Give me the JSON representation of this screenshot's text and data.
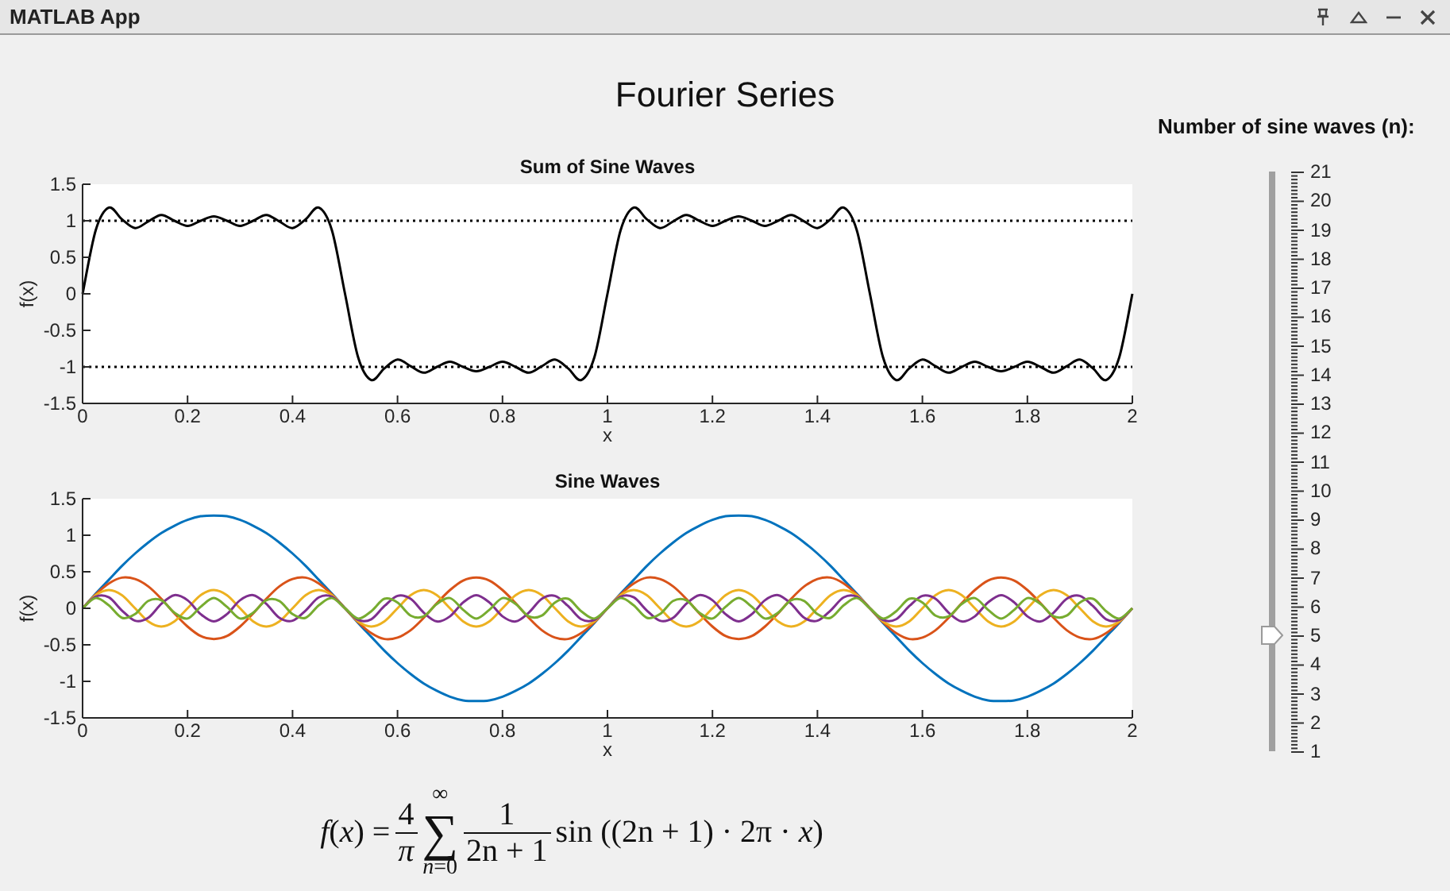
{
  "window": {
    "title": "MATLAB App"
  },
  "heading": "Fourier Series",
  "charts": [
    {
      "chart_data": {
        "type": "line",
        "title": "Sum of Sine Waves",
        "xlabel": "x",
        "ylabel": "f(x)",
        "xlim": [
          0,
          2
        ],
        "ylim": [
          -1.5,
          1.5
        ],
        "xticks": [
          {
            "value": 0,
            "label": "0"
          },
          {
            "value": 0.2,
            "label": "0.2"
          },
          {
            "value": 0.4,
            "label": "0.4"
          },
          {
            "value": 0.6,
            "label": "0.6"
          },
          {
            "value": 0.8,
            "label": "0.8"
          },
          {
            "value": 1,
            "label": "1"
          },
          {
            "value": 1.2,
            "label": "1.2"
          },
          {
            "value": 1.4,
            "label": "1.4"
          },
          {
            "value": 1.6,
            "label": "1.6"
          },
          {
            "value": 1.8,
            "label": "1.8"
          },
          {
            "value": 2,
            "label": "2"
          }
        ],
        "yticks": [
          {
            "value": -1.5,
            "label": "-1.5"
          },
          {
            "value": -1,
            "label": "-1"
          },
          {
            "value": -0.5,
            "label": "-0.5"
          },
          {
            "value": 0,
            "label": "0"
          },
          {
            "value": 0.5,
            "label": "0.5"
          },
          {
            "value": 1,
            "label": "1"
          },
          {
            "value": 1.5,
            "label": "1.5"
          }
        ],
        "x": [
          0,
          0.025,
          0.05,
          0.075,
          0.1,
          0.125,
          0.15,
          0.175,
          0.2,
          0.225,
          0.25,
          0.275,
          0.3,
          0.325,
          0.35,
          0.375,
          0.4,
          0.425,
          0.45,
          0.475,
          0.5,
          0.525,
          0.55,
          0.575,
          0.6,
          0.625,
          0.65,
          0.675,
          0.7,
          0.725,
          0.75,
          0.775,
          0.8,
          0.825,
          0.85,
          0.875,
          0.9,
          0.925,
          0.95,
          0.975,
          1,
          1.025,
          1.05,
          1.075,
          1.1,
          1.125,
          1.15,
          1.175,
          1.2,
          1.225,
          1.25,
          1.275,
          1.3,
          1.325,
          1.35,
          1.375,
          1.4,
          1.425,
          1.45,
          1.475,
          1.5,
          1.525,
          1.55,
          1.575,
          1.6,
          1.625,
          1.65,
          1.675,
          1.7,
          1.725,
          1.75,
          1.775,
          1.8,
          1.825,
          1.85,
          1.875,
          1.9,
          1.925,
          1.95,
          1.975,
          2
        ],
        "series": [
          {
            "color": "#000000",
            "values": [
              0,
              0.87,
              1.18,
              1.02,
              0.9,
              0.99,
              1.08,
              1,
              0.93,
              1,
              1.06,
              1,
              0.93,
              1,
              1.08,
              0.99,
              0.9,
              1.02,
              1.18,
              0.87,
              0,
              -0.87,
              -1.18,
              -1.02,
              -0.9,
              -0.99,
              -1.08,
              -1,
              -0.93,
              -1,
              -1.06,
              -1,
              -0.93,
              -1,
              -1.08,
              -0.99,
              -0.9,
              -1.02,
              -1.18,
              -0.87,
              0,
              0.87,
              1.18,
              1.02,
              0.9,
              0.99,
              1.08,
              1,
              0.93,
              1,
              1.06,
              1,
              0.93,
              1,
              1.08,
              0.99,
              0.9,
              1.02,
              1.18,
              0.87,
              0,
              -0.87,
              -1.18,
              -1.02,
              -0.9,
              -0.99,
              -1.08,
              -1,
              -0.93,
              -1,
              -1.06,
              -1,
              -0.93,
              -1,
              -1.08,
              -0.99,
              -0.9,
              -1.02,
              -1.18,
              -0.87,
              0
            ]
          },
          {
            "color": "#000000",
            "line_style": "dotted",
            "values": [
              1,
              1,
              1,
              1,
              1,
              1,
              1,
              1,
              1,
              1,
              1,
              1,
              1,
              1,
              1,
              1,
              1,
              1,
              1,
              1,
              1,
              1,
              1,
              1,
              1,
              1,
              1,
              1,
              1,
              1,
              1,
              1,
              1,
              1,
              1,
              1,
              1,
              1,
              1,
              1,
              1,
              1,
              1,
              1,
              1,
              1,
              1,
              1,
              1,
              1,
              1,
              1,
              1,
              1,
              1,
              1,
              1,
              1,
              1,
              1,
              1,
              1,
              1,
              1,
              1,
              1,
              1,
              1,
              1,
              1,
              1,
              1,
              1,
              1,
              1,
              1,
              1,
              1,
              1,
              1,
              1
            ]
          },
          {
            "color": "#000000",
            "line_style": "dotted",
            "values": [
              -1,
              -1,
              -1,
              -1,
              -1,
              -1,
              -1,
              -1,
              -1,
              -1,
              -1,
              -1,
              -1,
              -1,
              -1,
              -1,
              -1,
              -1,
              -1,
              -1,
              -1,
              -1,
              -1,
              -1,
              -1,
              -1,
              -1,
              -1,
              -1,
              -1,
              -1,
              -1,
              -1,
              -1,
              -1,
              -1,
              -1,
              -1,
              -1,
              -1,
              -1,
              -1,
              -1,
              -1,
              -1,
              -1,
              -1,
              -1,
              -1,
              -1,
              -1,
              -1,
              -1,
              -1,
              -1,
              -1,
              -1,
              -1,
              -1,
              -1,
              -1,
              -1,
              -1,
              -1,
              -1,
              -1,
              -1,
              -1,
              -1,
              -1,
              -1,
              -1,
              -1,
              -1,
              -1,
              -1,
              -1,
              -1,
              -1,
              -1,
              -1
            ]
          }
        ]
      }
    },
    {
      "chart_data": {
        "type": "line",
        "title": "Sine Waves",
        "xlabel": "x",
        "ylabel": "f(x)",
        "xlim": [
          0,
          2
        ],
        "ylim": [
          -1.5,
          1.5
        ],
        "xticks": [
          {
            "value": 0,
            "label": "0"
          },
          {
            "value": 0.2,
            "label": "0.2"
          },
          {
            "value": 0.4,
            "label": "0.4"
          },
          {
            "value": 0.6,
            "label": "0.6"
          },
          {
            "value": 0.8,
            "label": "0.8"
          },
          {
            "value": 1,
            "label": "1"
          },
          {
            "value": 1.2,
            "label": "1.2"
          },
          {
            "value": 1.4,
            "label": "1.4"
          },
          {
            "value": 1.6,
            "label": "1.6"
          },
          {
            "value": 1.8,
            "label": "1.8"
          },
          {
            "value": 2,
            "label": "2"
          }
        ],
        "yticks": [
          {
            "value": -1.5,
            "label": "-1.5"
          },
          {
            "value": -1,
            "label": "-1"
          },
          {
            "value": -0.5,
            "label": "-0.5"
          },
          {
            "value": 0,
            "label": "0"
          },
          {
            "value": 0.5,
            "label": "0.5"
          },
          {
            "value": 1,
            "label": "1"
          },
          {
            "value": 1.5,
            "label": "1.5"
          }
        ],
        "x": [
          0,
          0.025,
          0.05,
          0.075,
          0.1,
          0.125,
          0.15,
          0.175,
          0.2,
          0.225,
          0.25,
          0.275,
          0.3,
          0.325,
          0.35,
          0.375,
          0.4,
          0.425,
          0.45,
          0.475,
          0.5,
          0.525,
          0.55,
          0.575,
          0.6,
          0.625,
          0.65,
          0.675,
          0.7,
          0.725,
          0.75,
          0.775,
          0.8,
          0.825,
          0.85,
          0.875,
          0.9,
          0.925,
          0.95,
          0.975,
          1,
          1.025,
          1.05,
          1.075,
          1.1,
          1.125,
          1.15,
          1.175,
          1.2,
          1.225,
          1.25,
          1.275,
          1.3,
          1.325,
          1.35,
          1.375,
          1.4,
          1.425,
          1.45,
          1.475,
          1.5,
          1.525,
          1.55,
          1.575,
          1.6,
          1.625,
          1.65,
          1.675,
          1.7,
          1.725,
          1.75,
          1.775,
          1.8,
          1.825,
          1.85,
          1.875,
          1.9,
          1.925,
          1.95,
          1.975,
          2
        ],
        "series": [
          {
            "color": "#0072bd",
            "values": [
              0,
              0.2,
              0.39,
              0.58,
              0.75,
              0.9,
              1.03,
              1.13,
              1.21,
              1.26,
              1.27,
              1.26,
              1.21,
              1.13,
              1.03,
              0.9,
              0.75,
              0.58,
              0.39,
              0.2,
              0,
              -0.2,
              -0.39,
              -0.58,
              -0.75,
              -0.9,
              -1.03,
              -1.13,
              -1.21,
              -1.26,
              -1.27,
              -1.26,
              -1.21,
              -1.13,
              -1.03,
              -0.9,
              -0.75,
              -0.58,
              -0.39,
              -0.2,
              0,
              0.2,
              0.39,
              0.58,
              0.75,
              0.9,
              1.03,
              1.13,
              1.21,
              1.26,
              1.27,
              1.26,
              1.21,
              1.13,
              1.03,
              0.9,
              0.75,
              0.58,
              0.39,
              0.2,
              0,
              -0.2,
              -0.39,
              -0.58,
              -0.75,
              -0.9,
              -1.03,
              -1.13,
              -1.21,
              -1.26,
              -1.27,
              -1.26,
              -1.21,
              -1.13,
              -1.03,
              -0.9,
              -0.75,
              -0.58,
              -0.39,
              -0.2,
              0
            ]
          },
          {
            "color": "#d95319",
            "values": [
              0,
              0.19,
              0.34,
              0.42,
              0.4,
              0.3,
              0.13,
              -0.07,
              -0.25,
              -0.38,
              -0.42,
              -0.38,
              -0.25,
              -0.07,
              0.13,
              0.3,
              0.4,
              0.42,
              0.34,
              0.19,
              0,
              -0.19,
              -0.34,
              -0.42,
              -0.4,
              -0.3,
              -0.13,
              0.07,
              0.25,
              0.38,
              0.42,
              0.38,
              0.25,
              0.07,
              -0.13,
              -0.3,
              -0.4,
              -0.42,
              -0.34,
              -0.19,
              0,
              0.19,
              0.34,
              0.42,
              0.4,
              0.3,
              0.13,
              -0.07,
              -0.25,
              -0.38,
              -0.42,
              -0.38,
              -0.25,
              -0.07,
              0.13,
              0.3,
              0.4,
              0.42,
              0.34,
              0.19,
              0,
              -0.19,
              -0.34,
              -0.42,
              -0.4,
              -0.3,
              -0.13,
              0.07,
              0.25,
              0.38,
              0.42,
              0.38,
              0.25,
              0.07,
              -0.13,
              -0.3,
              -0.4,
              -0.42,
              -0.34,
              -0.19,
              0
            ]
          },
          {
            "color": "#edb120",
            "values": [
              0,
              0.18,
              0.25,
              0.18,
              0,
              -0.18,
              -0.25,
              -0.18,
              0,
              0.18,
              0.25,
              0.18,
              0,
              -0.18,
              -0.25,
              -0.18,
              0,
              0.18,
              0.25,
              0.18,
              0,
              -0.18,
              -0.25,
              -0.18,
              0,
              0.18,
              0.25,
              0.18,
              0,
              -0.18,
              -0.25,
              -0.18,
              0,
              0.18,
              0.25,
              0.18,
              0,
              -0.18,
              -0.25,
              -0.18,
              0,
              0.18,
              0.25,
              0.18,
              0,
              -0.18,
              -0.25,
              -0.18,
              0,
              0.18,
              0.25,
              0.18,
              0,
              -0.18,
              -0.25,
              -0.18,
              0,
              0.18,
              0.25,
              0.18,
              0,
              -0.18,
              -0.25,
              -0.18,
              0,
              0.18,
              0.25,
              0.18,
              0,
              -0.18,
              -0.25,
              -0.18,
              0,
              0.18,
              0.25,
              0.18,
              0,
              -0.18,
              -0.25,
              -0.18,
              0
            ]
          },
          {
            "color": "#7e2f8e",
            "values": [
              0,
              0.16,
              0.15,
              -0.03,
              -0.17,
              -0.13,
              0.06,
              0.18,
              0.11,
              -0.08,
              -0.18,
              -0.08,
              0.11,
              0.18,
              0.06,
              -0.13,
              -0.17,
              -0.03,
              0.15,
              0.16,
              0,
              -0.16,
              -0.15,
              0.03,
              0.17,
              0.13,
              -0.06,
              -0.18,
              -0.11,
              0.08,
              0.18,
              0.08,
              -0.11,
              -0.18,
              -0.06,
              0.13,
              0.17,
              0.03,
              -0.15,
              -0.16,
              0,
              0.16,
              0.15,
              -0.03,
              -0.17,
              -0.13,
              0.06,
              0.18,
              0.11,
              -0.08,
              -0.18,
              -0.08,
              0.11,
              0.18,
              0.06,
              -0.13,
              -0.17,
              -0.03,
              0.15,
              0.16,
              0,
              -0.16,
              -0.15,
              0.03,
              0.17,
              0.13,
              -0.06,
              -0.18,
              -0.11,
              0.08,
              0.18,
              0.08,
              -0.11,
              -0.18,
              -0.06,
              0.13,
              0.17,
              0.03,
              -0.15,
              -0.16,
              0
            ]
          },
          {
            "color": "#77ac30",
            "values": [
              0,
              0.14,
              0.04,
              -0.13,
              -0.08,
              0.1,
              0.11,
              -0.06,
              -0.14,
              0.02,
              0.14,
              0.02,
              -0.14,
              -0.06,
              0.11,
              0.1,
              -0.08,
              -0.13,
              0.04,
              0.14,
              0,
              -0.14,
              -0.04,
              0.13,
              0.08,
              -0.1,
              -0.11,
              0.06,
              0.14,
              -0.02,
              -0.14,
              -0.02,
              0.14,
              0.06,
              -0.11,
              -0.1,
              0.08,
              0.13,
              -0.04,
              -0.14,
              0,
              0.14,
              0.04,
              -0.13,
              -0.08,
              0.1,
              0.11,
              -0.06,
              -0.14,
              0.02,
              0.14,
              0.02,
              -0.14,
              -0.06,
              0.11,
              0.1,
              -0.08,
              -0.13,
              0.04,
              0.14,
              0,
              -0.14,
              -0.04,
              0.13,
              0.08,
              -0.1,
              -0.11,
              0.06,
              0.14,
              -0.02,
              -0.14,
              -0.02,
              0.14,
              0.06,
              -0.11,
              -0.1,
              0.08,
              0.13,
              -0.04,
              -0.14,
              0
            ]
          }
        ]
      }
    }
  ],
  "formula": {
    "lhs": "*f*(*x*) =",
    "coef_num": "4",
    "coef_den": "*π*",
    "sum_upper": "∞",
    "sum_symbol": "∑",
    "sum_lower": "*n*=0",
    "frac_num": "1",
    "frac_den": "2n + 1",
    "tail": "sin ((2n + 1) · 2π · *x*)"
  },
  "slider": {
    "label": "Number of sine waves (n):",
    "level": 0.2,
    "tick_labels": [
      "21",
      "20",
      "19",
      "18",
      "17",
      "16",
      "15",
      "14",
      "13",
      "12",
      "11",
      "10",
      "9",
      "8",
      "7",
      "6",
      "5",
      "4",
      "3",
      "2",
      "1"
    ]
  }
}
